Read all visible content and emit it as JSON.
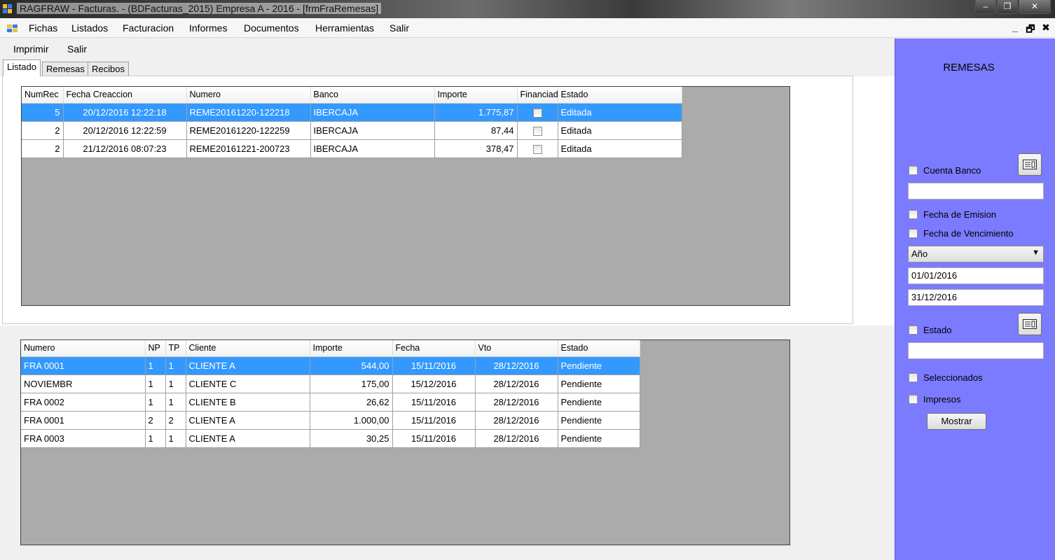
{
  "window": {
    "title": "RAGFRAW - Facturas. - (BDFacturas_2015)   Empresa A - 2016 - [frmFraRemesas]",
    "minimize": "–",
    "restore": "❐",
    "close": "✕"
  },
  "menu": {
    "items": [
      "Fichas",
      "Listados",
      "Facturacion",
      "Informes",
      "Documentos",
      "Herramientas",
      "Salir"
    ],
    "mdi_min": "_",
    "mdi_restore": "🗗",
    "mdi_close": "✖"
  },
  "toolstrip": {
    "items": [
      "Imprimir",
      "Salir"
    ]
  },
  "tabs": [
    "Listado",
    "Remesas",
    "Recibos"
  ],
  "remesas_grid": {
    "columns": [
      "NumRec",
      "Fecha Creaccion",
      "Numero",
      "Banco",
      "Importe",
      "Financiad",
      "Estado"
    ],
    "rows": [
      {
        "numrec": "5",
        "fecha": "20/12/2016 12:22:18",
        "numero": "REME20161220-122218",
        "banco": "IBERCAJA",
        "importe": "1.775,87",
        "financiada": false,
        "estado": "Editada",
        "selected": true
      },
      {
        "numrec": "2",
        "fecha": "20/12/2016 12:22:59",
        "numero": "REME20161220-122259",
        "banco": "IBERCAJA",
        "importe": "87,44",
        "financiada": false,
        "estado": "Editada",
        "selected": false
      },
      {
        "numrec": "2",
        "fecha": "21/12/2016 08:07:23",
        "numero": "REME20161221-200723",
        "banco": "IBERCAJA",
        "importe": "378,47",
        "financiada": false,
        "estado": "Editada",
        "selected": false
      }
    ]
  },
  "recibos_grid": {
    "columns": [
      "Numero",
      "NP",
      "TP",
      "Cliente",
      "Importe",
      "Fecha",
      "Vto",
      "Estado"
    ],
    "rows": [
      {
        "numero": "FRA 0001",
        "np": "1",
        "tp": "1",
        "cliente": "CLIENTE A",
        "importe": "544,00",
        "fecha": "15/11/2016",
        "vto": "28/12/2016",
        "estado": "Pendiente",
        "selected": true
      },
      {
        "numero": "NOVIEMBR",
        "np": "1",
        "tp": "1",
        "cliente": "CLIENTE C",
        "importe": "175,00",
        "fecha": "15/12/2016",
        "vto": "28/12/2016",
        "estado": "Pendiente",
        "selected": false
      },
      {
        "numero": "FRA 0002",
        "np": "1",
        "tp": "1",
        "cliente": "CLIENTE B",
        "importe": "26,62",
        "fecha": "15/11/2016",
        "vto": "28/12/2016",
        "estado": "Pendiente",
        "selected": false
      },
      {
        "numero": "FRA 0001",
        "np": "2",
        "tp": "2",
        "cliente": "CLIENTE A",
        "importe": "1.000,00",
        "fecha": "15/11/2016",
        "vto": "28/12/2016",
        "estado": "Pendiente",
        "selected": false
      },
      {
        "numero": "FRA 0003",
        "np": "1",
        "tp": "1",
        "cliente": "CLIENTE A",
        "importe": "30,25",
        "fecha": "15/11/2016",
        "vto": "28/12/2016",
        "estado": "Pendiente",
        "selected": false
      }
    ]
  },
  "filters": {
    "title": "REMESAS",
    "cuenta_banco": {
      "label": "Cuenta Banco",
      "checked": false,
      "value": ""
    },
    "fecha_emision": {
      "label": "Fecha de Emision",
      "checked": false
    },
    "fecha_vencimiento": {
      "label": "Fecha de Vencimiento",
      "checked": false
    },
    "periodo": {
      "selected": "Año",
      "arrow": "▼"
    },
    "fecha_desde": "01/01/2016",
    "fecha_hasta": "31/12/2016",
    "estado": {
      "label": "Estado",
      "checked": false,
      "value": ""
    },
    "seleccionados": {
      "label": "Seleccionados",
      "checked": false
    },
    "impresos": {
      "label": "Impresos",
      "checked": false
    },
    "mostrar_button": "Mostrar"
  },
  "colors": {
    "side_panel": "#7b7bff",
    "selection": "#3399ff",
    "grid_background": "#ababab"
  },
  "icons": {
    "app": "app-window-icon",
    "lookup": "list-lookup-icon"
  }
}
